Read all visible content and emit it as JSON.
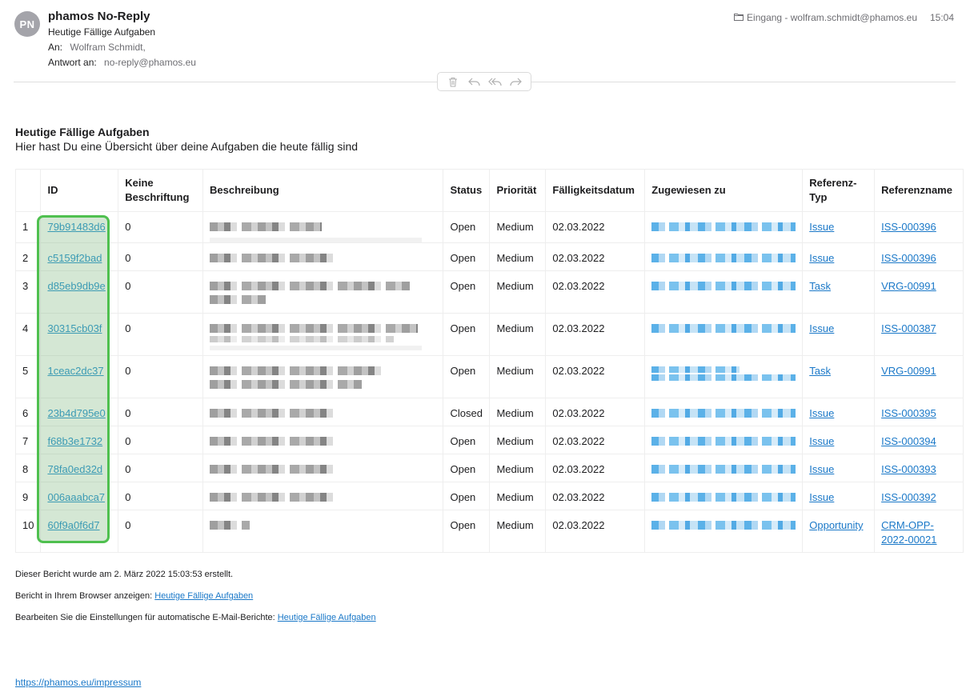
{
  "header": {
    "avatar_initials": "PN",
    "sender": "phamos No-Reply",
    "subject": "Heutige Fällige Aufgaben",
    "to_label": "An:",
    "to_value": "Wolfram Schmidt,",
    "reply_label": "Antwort an:",
    "reply_value": "no-reply@phamos.eu",
    "mailbox": "Eingang - wolfram.schmidt@phamos.eu",
    "time": "15:04"
  },
  "toolbar": {
    "icons": [
      "trash-icon",
      "reply-icon",
      "reply-all-icon",
      "forward-icon"
    ]
  },
  "report": {
    "title": "Heutige Fällige Aufgaben",
    "intro": "Hier hast Du eine Übersicht über deine Aufgaben die heute fällig sind"
  },
  "table": {
    "headers": {
      "id": "ID",
      "keine": "Keine Beschriftung",
      "beschreibung": "Beschreibung",
      "status": "Status",
      "prioritaet": "Priorität",
      "faelligkeit": "Fälligkeitsdatum",
      "zugewiesen": "Zugewiesen zu",
      "reftyp": "Referenz-Typ",
      "refname": "Referenzname"
    },
    "rows": [
      {
        "num": "1",
        "id": "79b91483d6",
        "keine": "0",
        "status": "Open",
        "prio": "Medium",
        "date": "02.03.2022",
        "reftyp": "Issue",
        "refname": "ISS-000396"
      },
      {
        "num": "2",
        "id": "c5159f2bad",
        "keine": "0",
        "status": "Open",
        "prio": "Medium",
        "date": "02.03.2022",
        "reftyp": "Issue",
        "refname": "ISS-000396"
      },
      {
        "num": "3",
        "id": "d85eb9db9e",
        "keine": "0",
        "status": "Open",
        "prio": "Medium",
        "date": "02.03.2022",
        "reftyp": "Task",
        "refname": "VRG-00991"
      },
      {
        "num": "4",
        "id": "30315cb03f",
        "keine": "0",
        "status": "Open",
        "prio": "Medium",
        "date": "02.03.2022",
        "reftyp": "Issue",
        "refname": "ISS-000387"
      },
      {
        "num": "5",
        "id": "1ceac2dc37",
        "keine": "0",
        "status": "Open",
        "prio": "Medium",
        "date": "02.03.2022",
        "reftyp": "Task",
        "refname": "VRG-00991"
      },
      {
        "num": "6",
        "id": "23b4d795e0",
        "keine": "0",
        "status": "Closed",
        "prio": "Medium",
        "date": "02.03.2022",
        "reftyp": "Issue",
        "refname": "ISS-000395"
      },
      {
        "num": "7",
        "id": "f68b3e1732",
        "keine": "0",
        "status": "Open",
        "prio": "Medium",
        "date": "02.03.2022",
        "reftyp": "Issue",
        "refname": "ISS-000394"
      },
      {
        "num": "8",
        "id": "78fa0ed32d",
        "keine": "0",
        "status": "Open",
        "prio": "Medium",
        "date": "02.03.2022",
        "reftyp": "Issue",
        "refname": "ISS-000393"
      },
      {
        "num": "9",
        "id": "006aaabca7",
        "keine": "0",
        "status": "Open",
        "prio": "Medium",
        "date": "02.03.2022",
        "reftyp": "Issue",
        "refname": "ISS-000392"
      },
      {
        "num": "10",
        "id": "60f9a0f6d7",
        "keine": "0",
        "status": "Open",
        "prio": "Medium",
        "date": "02.03.2022",
        "reftyp": "Opportunity",
        "refname": "CRM-OPP-2022-00021"
      }
    ]
  },
  "footer": {
    "created": "Dieser Bericht wurde am 2. März 2022 15:03:53 erstellt.",
    "browser_label": "Bericht in Ihrem Browser anzeigen:",
    "browser_link": "Heutige Fällige Aufgaben",
    "settings_label": "Bearbeiten Sie die Einstellungen für automatische E-Mail-Berichte:",
    "settings_link": "Heutige Fällige Aufgaben",
    "impressum": "https://phamos.eu/impressum"
  },
  "colors": {
    "link": "#1a78c8",
    "highlight_border": "#4fc04f",
    "avatar_bg": "#a4a4aa"
  }
}
